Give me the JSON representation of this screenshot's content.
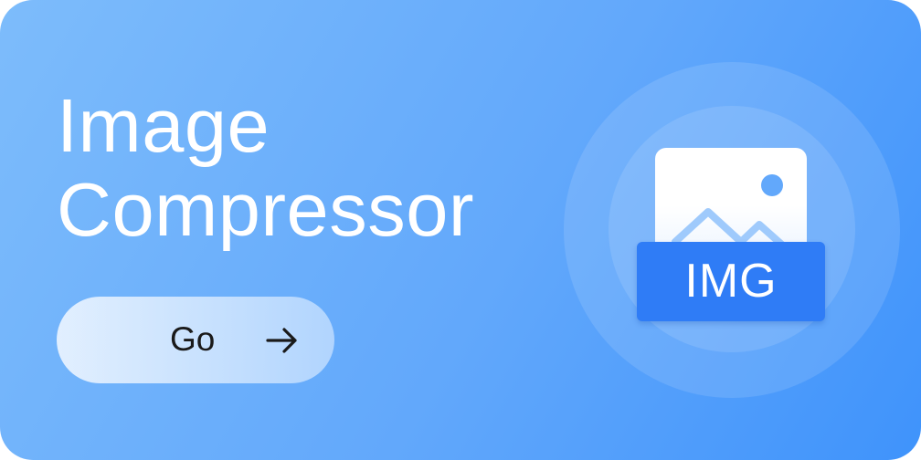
{
  "banner": {
    "title_line1": "Image",
    "title_line2": "Compressor",
    "go_label": "Go",
    "arrow_icon": "arrow-right-icon",
    "tag_text": "IMG",
    "colors": {
      "gradient_start": "#7dbcfb",
      "gradient_end": "#3f93fb",
      "tag_blue": "#2f7cf6",
      "button_text": "#1a1a1a"
    }
  }
}
